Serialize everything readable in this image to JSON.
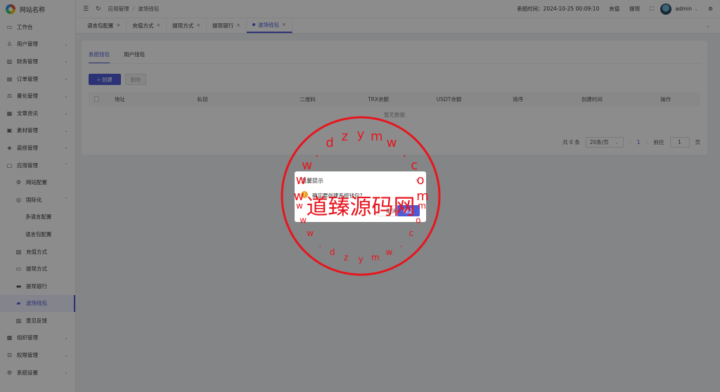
{
  "brand": {
    "name": "网站名称"
  },
  "sidebar": {
    "items": [
      {
        "label": "工作台",
        "icon": "monitor-icon",
        "level": 0,
        "chevron": ""
      },
      {
        "label": "用户管理",
        "icon": "user-icon",
        "level": 0,
        "chevron": "⌄"
      },
      {
        "label": "财务管理",
        "icon": "chart-icon",
        "level": 0,
        "chevron": "⌄"
      },
      {
        "label": "订单管理",
        "icon": "order-icon",
        "level": 0,
        "chevron": "⌄"
      },
      {
        "label": "量化管理",
        "icon": "scale-icon",
        "level": 0,
        "chevron": "⌄"
      },
      {
        "label": "文章资讯",
        "icon": "article-icon",
        "level": 0,
        "chevron": "⌄"
      },
      {
        "label": "素材管理",
        "icon": "image-icon",
        "level": 0,
        "chevron": "⌄"
      },
      {
        "label": "装修管理",
        "icon": "decor-icon",
        "level": 0,
        "chevron": "⌄"
      },
      {
        "label": "应用管理",
        "icon": "app-icon",
        "level": 0,
        "chevron": "⌃"
      },
      {
        "label": "网站配置",
        "icon": "settings-icon",
        "level": 1,
        "chevron": ""
      },
      {
        "label": "国际化",
        "icon": "globe-icon",
        "level": 1,
        "chevron": "⌃"
      },
      {
        "label": "多语言配置",
        "icon": "",
        "level": 2,
        "chevron": ""
      },
      {
        "label": "语言包配置",
        "icon": "",
        "level": 2,
        "chevron": ""
      },
      {
        "label": "充值方式",
        "icon": "deposit-icon",
        "level": 1,
        "chevron": ""
      },
      {
        "label": "提现方式",
        "icon": "folder-icon",
        "level": 1,
        "chevron": ""
      },
      {
        "label": "提现银行",
        "icon": "card-icon",
        "level": 1,
        "chevron": ""
      },
      {
        "label": "波场钱包",
        "icon": "wallet-icon",
        "level": 1,
        "chevron": "",
        "active": true
      },
      {
        "label": "意见反馈",
        "icon": "feedback-icon",
        "level": 1,
        "chevron": ""
      },
      {
        "label": "组织管理",
        "icon": "org-icon",
        "level": 0,
        "chevron": "⌄"
      },
      {
        "label": "权限管理",
        "icon": "lock-icon",
        "level": 0,
        "chevron": "⌄"
      },
      {
        "label": "系统设置",
        "icon": "gear-icon",
        "level": 0,
        "chevron": "⌄"
      }
    ]
  },
  "topbar": {
    "breadcrumb": [
      "应用管理",
      "波场钱包"
    ],
    "system_time": "系统时间：2024-10-25 00:09:10",
    "recharge": "充值",
    "withdraw": "提现",
    "username": "admin"
  },
  "tabs": [
    {
      "label": "语言包配置",
      "active": false
    },
    {
      "label": "充值方式",
      "active": false
    },
    {
      "label": "提现方式",
      "active": false
    },
    {
      "label": "提现银行",
      "active": false
    },
    {
      "label": "波场钱包",
      "active": true
    }
  ],
  "content": {
    "subtabs": [
      "系统钱包",
      "用户钱包"
    ],
    "create_button": "+ 创建",
    "delete_button": "删除",
    "columns": [
      "地址",
      "私钥",
      "二维码",
      "TRX余额",
      "USDT余额",
      "排序",
      "创建时间",
      "操作"
    ],
    "empty_text": "暂无数据",
    "pager": {
      "total": "共 0 条",
      "page_size": "20条/页",
      "current": "1",
      "goto_label": "前往",
      "goto_value": "1",
      "page_suffix": "页"
    }
  },
  "dialog": {
    "title": "温馨提示",
    "message": "确定要创建系统钱包?",
    "cancel": "取消",
    "ok": "确定"
  },
  "watermark": {
    "center_text": "道臻源码网",
    "top_arc": [
      "w",
      "w",
      "w",
      ".",
      "d",
      "z",
      "y",
      "m",
      "w",
      ".",
      "c",
      "o",
      "m"
    ],
    "bottom_arc": [
      "w",
      "w",
      "w",
      ".",
      "d",
      "z",
      "y",
      "m",
      "w",
      ".",
      "c",
      "o",
      "m"
    ],
    "color": "#e8141e"
  },
  "colors": {
    "primary": "#4f5bd5",
    "warning": "#f0a020"
  }
}
